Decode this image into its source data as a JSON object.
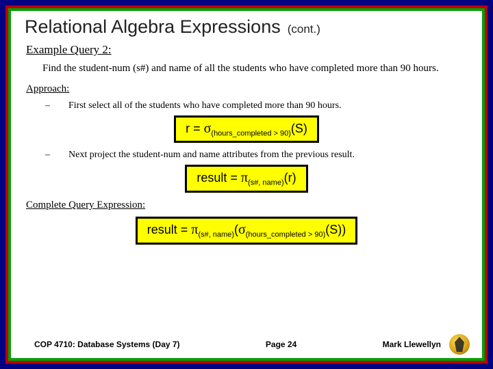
{
  "title": {
    "main": "Relational Algebra Expressions",
    "cont": "(cont.)"
  },
  "example_heading": "Example Query 2:",
  "query_text": "Find the student-num (s#) and name of all the students who have completed more than 90 hours.",
  "approach_heading": "Approach:",
  "steps": {
    "0": {
      "dash": "–",
      "text": "First select all of the students who have completed more than 90 hours."
    },
    "1": {
      "dash": "–",
      "text": "Next project the student-num and name attributes from the previous result."
    }
  },
  "formulas": {
    "f1": {
      "lhs": "r = ",
      "sub": "(hours_completed > 90)",
      "arg": "(S)"
    },
    "f2": {
      "lhs": "result = ",
      "sub": "(s#, name)",
      "arg": "(r)"
    },
    "f3": {
      "lhs": "result = ",
      "sub1": "(s#, name)",
      "mid": "(",
      "sub2": "(hours_completed > 90)",
      "arg": "(S))"
    }
  },
  "complete_heading": "Complete Query Expression:",
  "footer": {
    "course": "COP 4710: Database Systems (Day 7)",
    "page": "Page 24",
    "author": "Mark Llewellyn"
  }
}
